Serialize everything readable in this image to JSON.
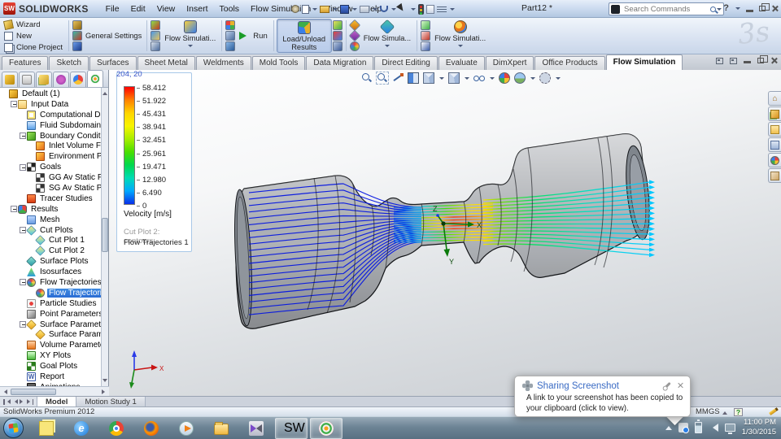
{
  "titlebar": {
    "logo_text": "SW",
    "brand": "SOLIDWORKS",
    "menus": [
      "File",
      "Edit",
      "View",
      "Insert",
      "Tools",
      "Flow Simulation",
      "Window",
      "Help"
    ],
    "title": "Part12 *",
    "search_placeholder": "Search Commands"
  },
  "toolbar": {
    "wizard": "Wizard",
    "new": "New",
    "clone_project": "Clone Project",
    "general_settings": "General Settings",
    "flow_simulation_1": "Flow Simulati...",
    "run": "Run",
    "load_unload": "Load/Unload Results",
    "flow_simulation_2": "Flow Simula...",
    "flow_simulation_3": "Flow Simulati..."
  },
  "ribbon_tabs": {
    "items": [
      "Features",
      "Sketch",
      "Surfaces",
      "Sheet Metal",
      "Weldments",
      "Mold Tools",
      "Data Migration",
      "Direct Editing",
      "Evaluate",
      "DimXpert",
      "Office Products",
      "Flow Simulation"
    ],
    "active": "Flow Simulation"
  },
  "tree": {
    "items": [
      {
        "label": "Default (1)",
        "level": 0,
        "icon": "default"
      },
      {
        "label": "Input Data",
        "level": 1,
        "icon": "folder",
        "exp": true
      },
      {
        "label": "Computational Don",
        "level": 2,
        "icon": "domain"
      },
      {
        "label": "Fluid Subdomains",
        "level": 2,
        "icon": "fluid"
      },
      {
        "label": "Boundary Condition",
        "level": 2,
        "icon": "boundary",
        "exp": true
      },
      {
        "label": "Inlet Volume Fl",
        "level": 3,
        "icon": "inlet"
      },
      {
        "label": "Environment Pr",
        "level": 3,
        "icon": "inlet"
      },
      {
        "label": "Goals",
        "level": 2,
        "icon": "goals",
        "exp": true
      },
      {
        "label": "GG Av Static Pr",
        "level": 3,
        "icon": "goal"
      },
      {
        "label": "SG Av Static Pre",
        "level": 3,
        "icon": "goal"
      },
      {
        "label": "Tracer Studies",
        "level": 2,
        "icon": "tracer"
      },
      {
        "label": "Results",
        "level": 1,
        "icon": "results",
        "exp": true
      },
      {
        "label": "Mesh",
        "level": 2,
        "icon": "mesh"
      },
      {
        "label": "Cut Plots",
        "level": 2,
        "icon": "cutplot",
        "exp": true
      },
      {
        "label": "Cut Plot 1",
        "level": 3,
        "icon": "cutplot"
      },
      {
        "label": "Cut Plot 2",
        "level": 3,
        "icon": "cutplot"
      },
      {
        "label": "Surface Plots",
        "level": 2,
        "icon": "surfplot"
      },
      {
        "label": "Isosurfaces",
        "level": 2,
        "icon": "iso"
      },
      {
        "label": "Flow Trajectories",
        "level": 2,
        "icon": "flowtraj",
        "exp": true
      },
      {
        "label": "Flow Trajectorie",
        "level": 3,
        "icon": "flowtraj",
        "selected": true
      },
      {
        "label": "Particle Studies",
        "level": 2,
        "icon": "particle"
      },
      {
        "label": "Point Parameters",
        "level": 2,
        "icon": "point"
      },
      {
        "label": "Surface Parameters",
        "level": 2,
        "icon": "surfparam",
        "exp": true
      },
      {
        "label": "Surface Parame",
        "level": 3,
        "icon": "surfparam"
      },
      {
        "label": "Volume Parameters",
        "level": 2,
        "icon": "volparam"
      },
      {
        "label": "XY Plots",
        "level": 2,
        "icon": "xyplot"
      },
      {
        "label": "Goal Plots",
        "level": 2,
        "icon": "goalplot"
      },
      {
        "label": "Report",
        "level": 2,
        "icon": "report"
      },
      {
        "label": "Animations",
        "level": 2,
        "icon": "anim"
      }
    ]
  },
  "legend": {
    "values": [
      "58.412",
      "51.922",
      "45.431",
      "38.941",
      "32.451",
      "25.961",
      "19.471",
      "12.980",
      "6.490",
      "0"
    ],
    "colors": [
      "#ff0000",
      "#ff8000",
      "#ffd500",
      "#f8f400",
      "#a8ee00",
      "#4ade00",
      "#00d84e",
      "#00dcb4",
      "#00a8ff",
      "#0a2fe8"
    ],
    "title": "Velocity [m/s]",
    "caption_top": "Cut Plot 2: contours",
    "caption_bottom": "Flow Trajectories 1"
  },
  "viewport": {
    "coords": "204, 20",
    "watermark": "3s",
    "axes": {
      "x": "X",
      "y": "Y",
      "z": "Z"
    },
    "toolbar_icons": [
      "zoom-fit",
      "zoom-area",
      "filter",
      "section-view",
      "view-orientation",
      "display-style",
      "hide-show-items",
      "edit-appearance",
      "apply-scene",
      "view-settings"
    ],
    "task_pane_icons": [
      "home",
      "design-library",
      "file-explorer",
      "toolbox",
      "appearances",
      "custom-properties"
    ]
  },
  "doc_tabs": {
    "items": [
      "Model",
      "Motion Study 1"
    ],
    "active": "Model"
  },
  "statusbar": {
    "left": "SolidWorks Premium 2012",
    "units": "MMGS"
  },
  "popup": {
    "title": "Sharing Screenshot",
    "body": "A link to your screenshot has been copied to your clipboard (click to view)."
  },
  "taskbar": {
    "apps": [
      {
        "key": "sticky",
        "name": "Sticky Notes"
      },
      {
        "key": "ie",
        "name": "Internet Explorer"
      },
      {
        "key": "chrome",
        "name": "Google Chrome"
      },
      {
        "key": "firefox",
        "name": "Mozilla Firefox"
      },
      {
        "key": "wmp",
        "name": "Windows Media Player"
      },
      {
        "key": "explorer",
        "name": "Windows Explorer"
      },
      {
        "key": "kmplayer",
        "name": "KMPlayer"
      },
      {
        "key": "solidworks",
        "name": "SolidWorks",
        "active": true
      },
      {
        "key": "flowsim",
        "name": "Flow Simulation",
        "active": true
      }
    ],
    "clock_time": "11:00 PM",
    "clock_date": "1/30/2015"
  }
}
